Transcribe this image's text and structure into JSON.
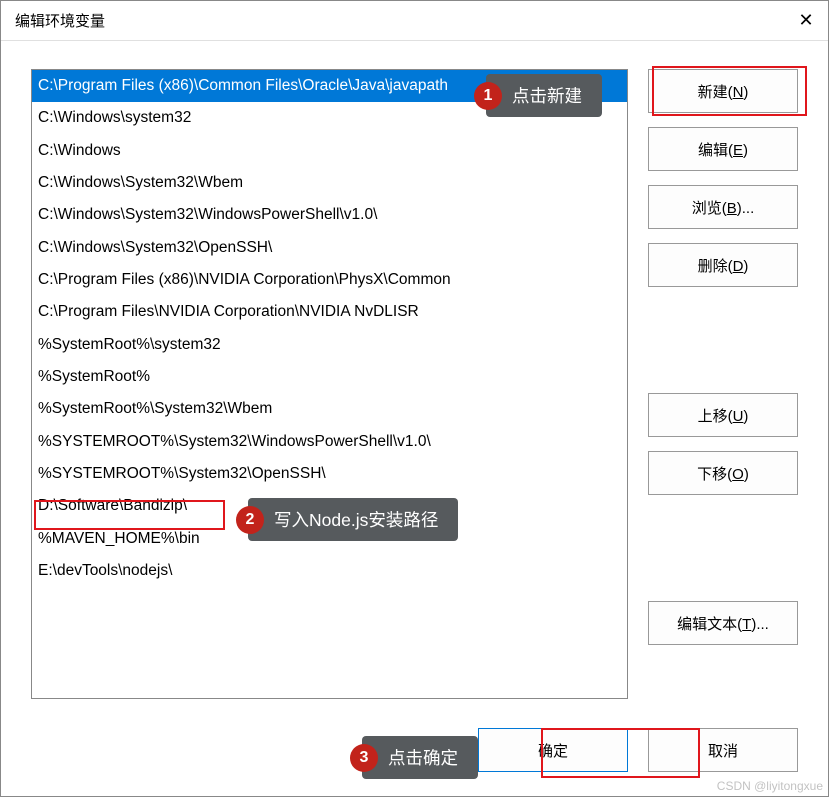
{
  "window": {
    "title": "编辑环境变量"
  },
  "list": {
    "items": [
      "C:\\Program Files (x86)\\Common Files\\Oracle\\Java\\javapath",
      "C:\\Windows\\system32",
      "C:\\Windows",
      "C:\\Windows\\System32\\Wbem",
      "C:\\Windows\\System32\\WindowsPowerShell\\v1.0\\",
      "C:\\Windows\\System32\\OpenSSH\\",
      "C:\\Program Files (x86)\\NVIDIA Corporation\\PhysX\\Common",
      "C:\\Program Files\\NVIDIA Corporation\\NVIDIA NvDLISR",
      "%SystemRoot%\\system32",
      "%SystemRoot%",
      "%SystemRoot%\\System32\\Wbem",
      "%SYSTEMROOT%\\System32\\WindowsPowerShell\\v1.0\\",
      "%SYSTEMROOT%\\System32\\OpenSSH\\",
      "D:\\Software\\Bandizip\\",
      "%MAVEN_HOME%\\bin",
      "E:\\devTools\\nodejs\\"
    ],
    "selected_index": 0
  },
  "buttons": {
    "new": {
      "label": "新建(",
      "hotkey": "N",
      "suffix": ")"
    },
    "edit": {
      "label": "编辑(",
      "hotkey": "E",
      "suffix": ")"
    },
    "browse": {
      "label": "浏览(",
      "hotkey": "B",
      "suffix": ")..."
    },
    "delete": {
      "label": "删除(",
      "hotkey": "D",
      "suffix": ")"
    },
    "moveup": {
      "label": "上移(",
      "hotkey": "U",
      "suffix": ")"
    },
    "movedown": {
      "label": "下移(",
      "hotkey": "O",
      "suffix": ")"
    },
    "edittext": {
      "label": "编辑文本(",
      "hotkey": "T",
      "suffix": ")..."
    },
    "ok": {
      "label": "确定"
    },
    "cancel": {
      "label": "取消"
    }
  },
  "annotations": {
    "a1": {
      "num": "1",
      "text": "点击新建"
    },
    "a2": {
      "num": "2",
      "text": "写入Node.js安装路径"
    },
    "a3": {
      "num": "3",
      "text": "点击确定"
    }
  },
  "watermark": "CSDN @liyitongxue"
}
